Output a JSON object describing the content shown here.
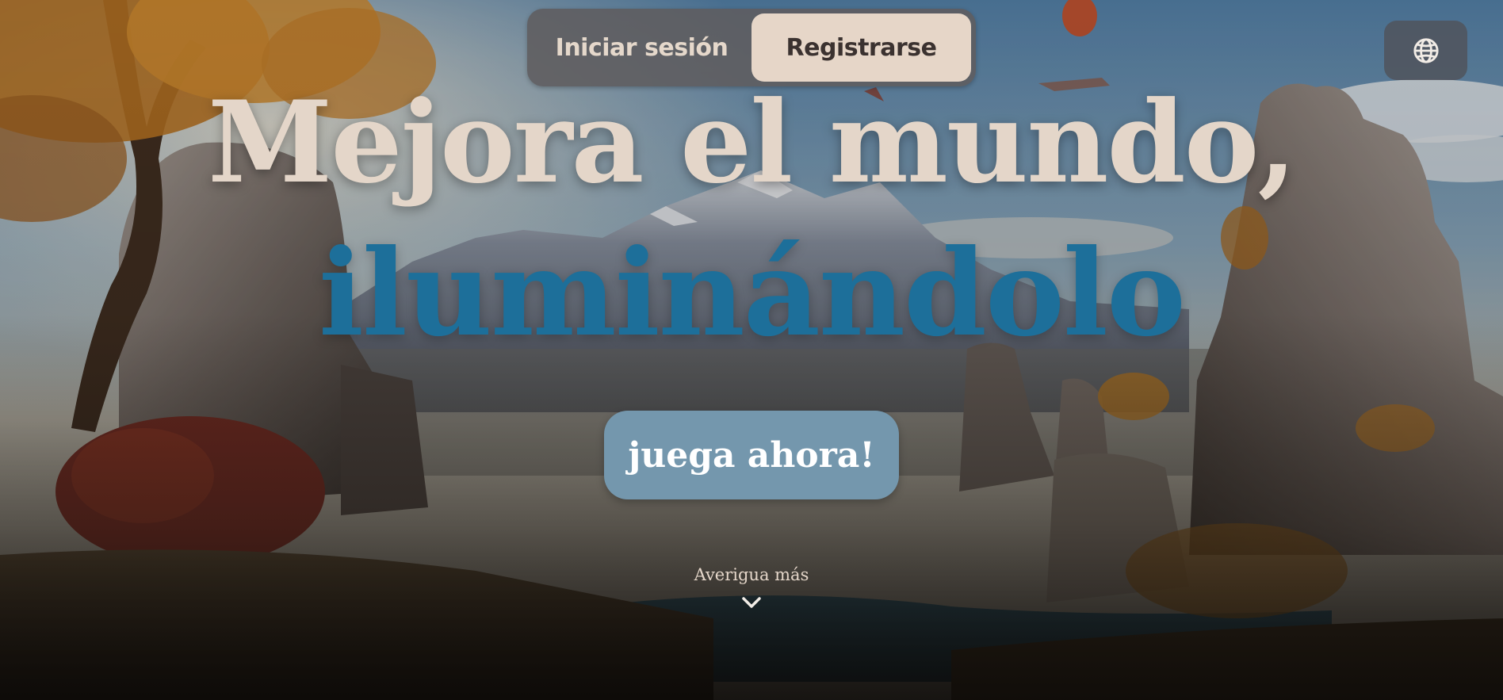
{
  "auth": {
    "login_label": "Iniciar sesión",
    "register_label": "Registrarse",
    "active": "register"
  },
  "language_button": {
    "icon": "globe-icon"
  },
  "hero": {
    "line1": "Mejora el mundo,",
    "line2": "iluminándolo"
  },
  "cta": {
    "play_label": "juega ahora!"
  },
  "learn_more": {
    "label": "Averigua más",
    "icon": "chevron-down-icon"
  },
  "colors": {
    "headline_primary": "#e4d6c9",
    "headline_accent": "#1d6f9a",
    "play_button": "#7497ad",
    "toggle_active": "#e6d6c8",
    "toggle_bg": "#5f5c5e"
  }
}
